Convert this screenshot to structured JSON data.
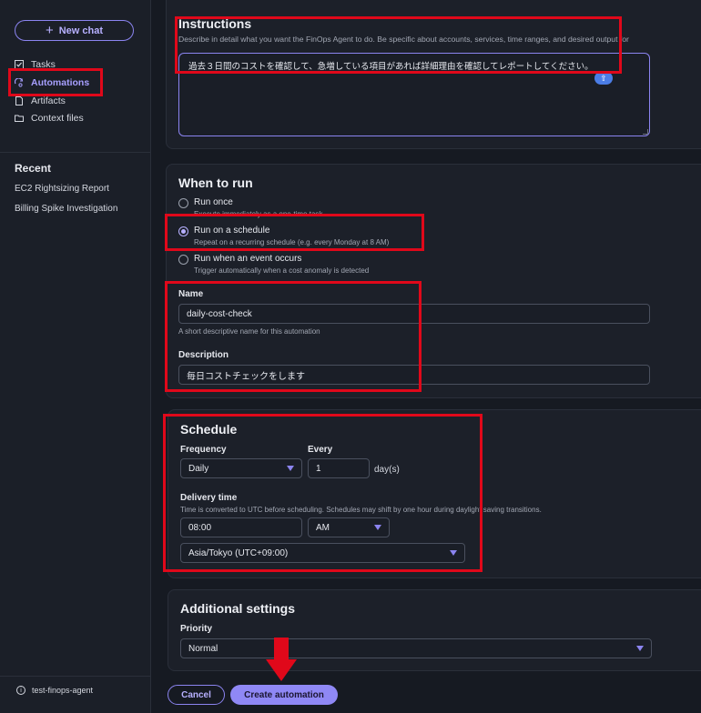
{
  "sidebar": {
    "new_chat": "New chat",
    "nav": [
      {
        "label": "Tasks",
        "icon": "checkbox-icon"
      },
      {
        "label": "Automations",
        "icon": "automation-icon",
        "active": true
      },
      {
        "label": "Artifacts",
        "icon": "file-icon"
      },
      {
        "label": "Context files",
        "icon": "folder-icon"
      }
    ],
    "recent_heading": "Recent",
    "recent": [
      "EC2 Rightsizing Report",
      "Billing Spike Investigation"
    ],
    "agent_name": "test-finops-agent"
  },
  "instructions": {
    "heading": "Instructions",
    "hint": "Describe in detail what you want the FinOps Agent to do. Be specific about accounts, services, time ranges, and desired output for",
    "value": "過去３日間のコストを確認して、急増している項目があれば詳細理由を確認してレポートしてください。"
  },
  "when_to_run": {
    "heading": "When to run",
    "options": [
      {
        "title": "Run once",
        "sub": "Execute immediately as a one-time task",
        "selected": false
      },
      {
        "title": "Run on a schedule",
        "sub": "Repeat on a recurring schedule (e.g. every Monday at 8 AM)",
        "selected": true
      },
      {
        "title": "Run when an event occurs",
        "sub": "Trigger automatically when a cost anomaly is detected",
        "selected": false
      }
    ],
    "name_label": "Name",
    "name_value": "daily-cost-check",
    "name_hint": "A short descriptive name for this automation",
    "description_label": "Description",
    "description_value": "毎日コストチェックをします"
  },
  "schedule": {
    "heading": "Schedule",
    "frequency_label": "Frequency",
    "frequency_value": "Daily",
    "every_label": "Every",
    "every_value": "1",
    "every_unit": "day(s)",
    "delivery_label": "Delivery time",
    "delivery_hint": "Time is converted to UTC before scheduling. Schedules may shift by one hour during daylight saving transitions.",
    "time_value": "08:00",
    "ampm_value": "AM",
    "timezone_value": "Asia/Tokyo (UTC+09:00)"
  },
  "additional": {
    "heading": "Additional settings",
    "priority_label": "Priority",
    "priority_value": "Normal"
  },
  "actions": {
    "cancel": "Cancel",
    "create": "Create automation"
  },
  "colors": {
    "accent": "#8f88f5",
    "annotation": "#e0081a",
    "background": "#161a22"
  }
}
